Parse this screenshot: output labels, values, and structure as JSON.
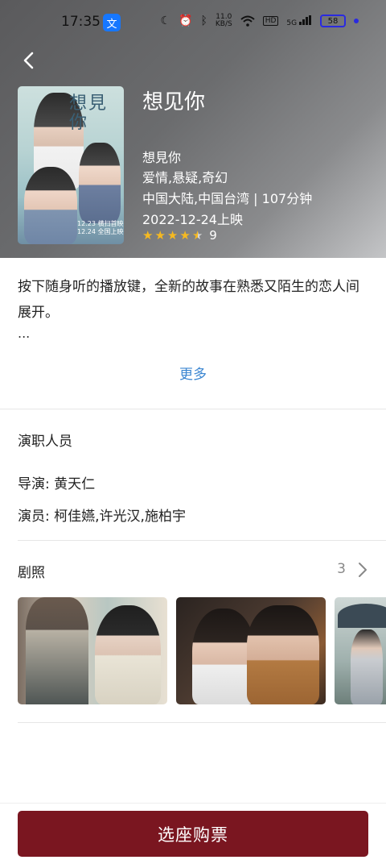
{
  "status_bar": {
    "time": "17:35",
    "net_speed_value": "11.0",
    "net_speed_unit": "KB/S",
    "hd_badge": "HD",
    "signal_label": "5G",
    "battery": "58"
  },
  "movie": {
    "title": "想见你",
    "alt_title": "想見你",
    "genres": "爱情,悬疑,奇幻",
    "region_duration": "中国大陆,中国台湾 | 107分钟",
    "release": "2022-12-24上映",
    "rating": "9",
    "rating_stars": 4.5,
    "poster": {
      "title_text": "想見你",
      "date_text_1": "12.23 横扫首映",
      "date_text_2": "12.24 全国上映"
    }
  },
  "synopsis": {
    "text": "按下随身听的播放键，全新的故事在熟悉又陌生的恋人间展开。",
    "ellipsis": "...",
    "more_label": "更多"
  },
  "cast": {
    "section_title": "演职人员",
    "director": "导演: 黄天仁",
    "actors": "演员: 柯佳嬿,许光汉,施柏宇"
  },
  "stills": {
    "section_title": "剧照",
    "count": "3"
  },
  "actions": {
    "buy_label": "选座购票"
  },
  "colors": {
    "accent_button": "#7a1620",
    "link": "#3b86d1",
    "star": "#f5b921"
  }
}
